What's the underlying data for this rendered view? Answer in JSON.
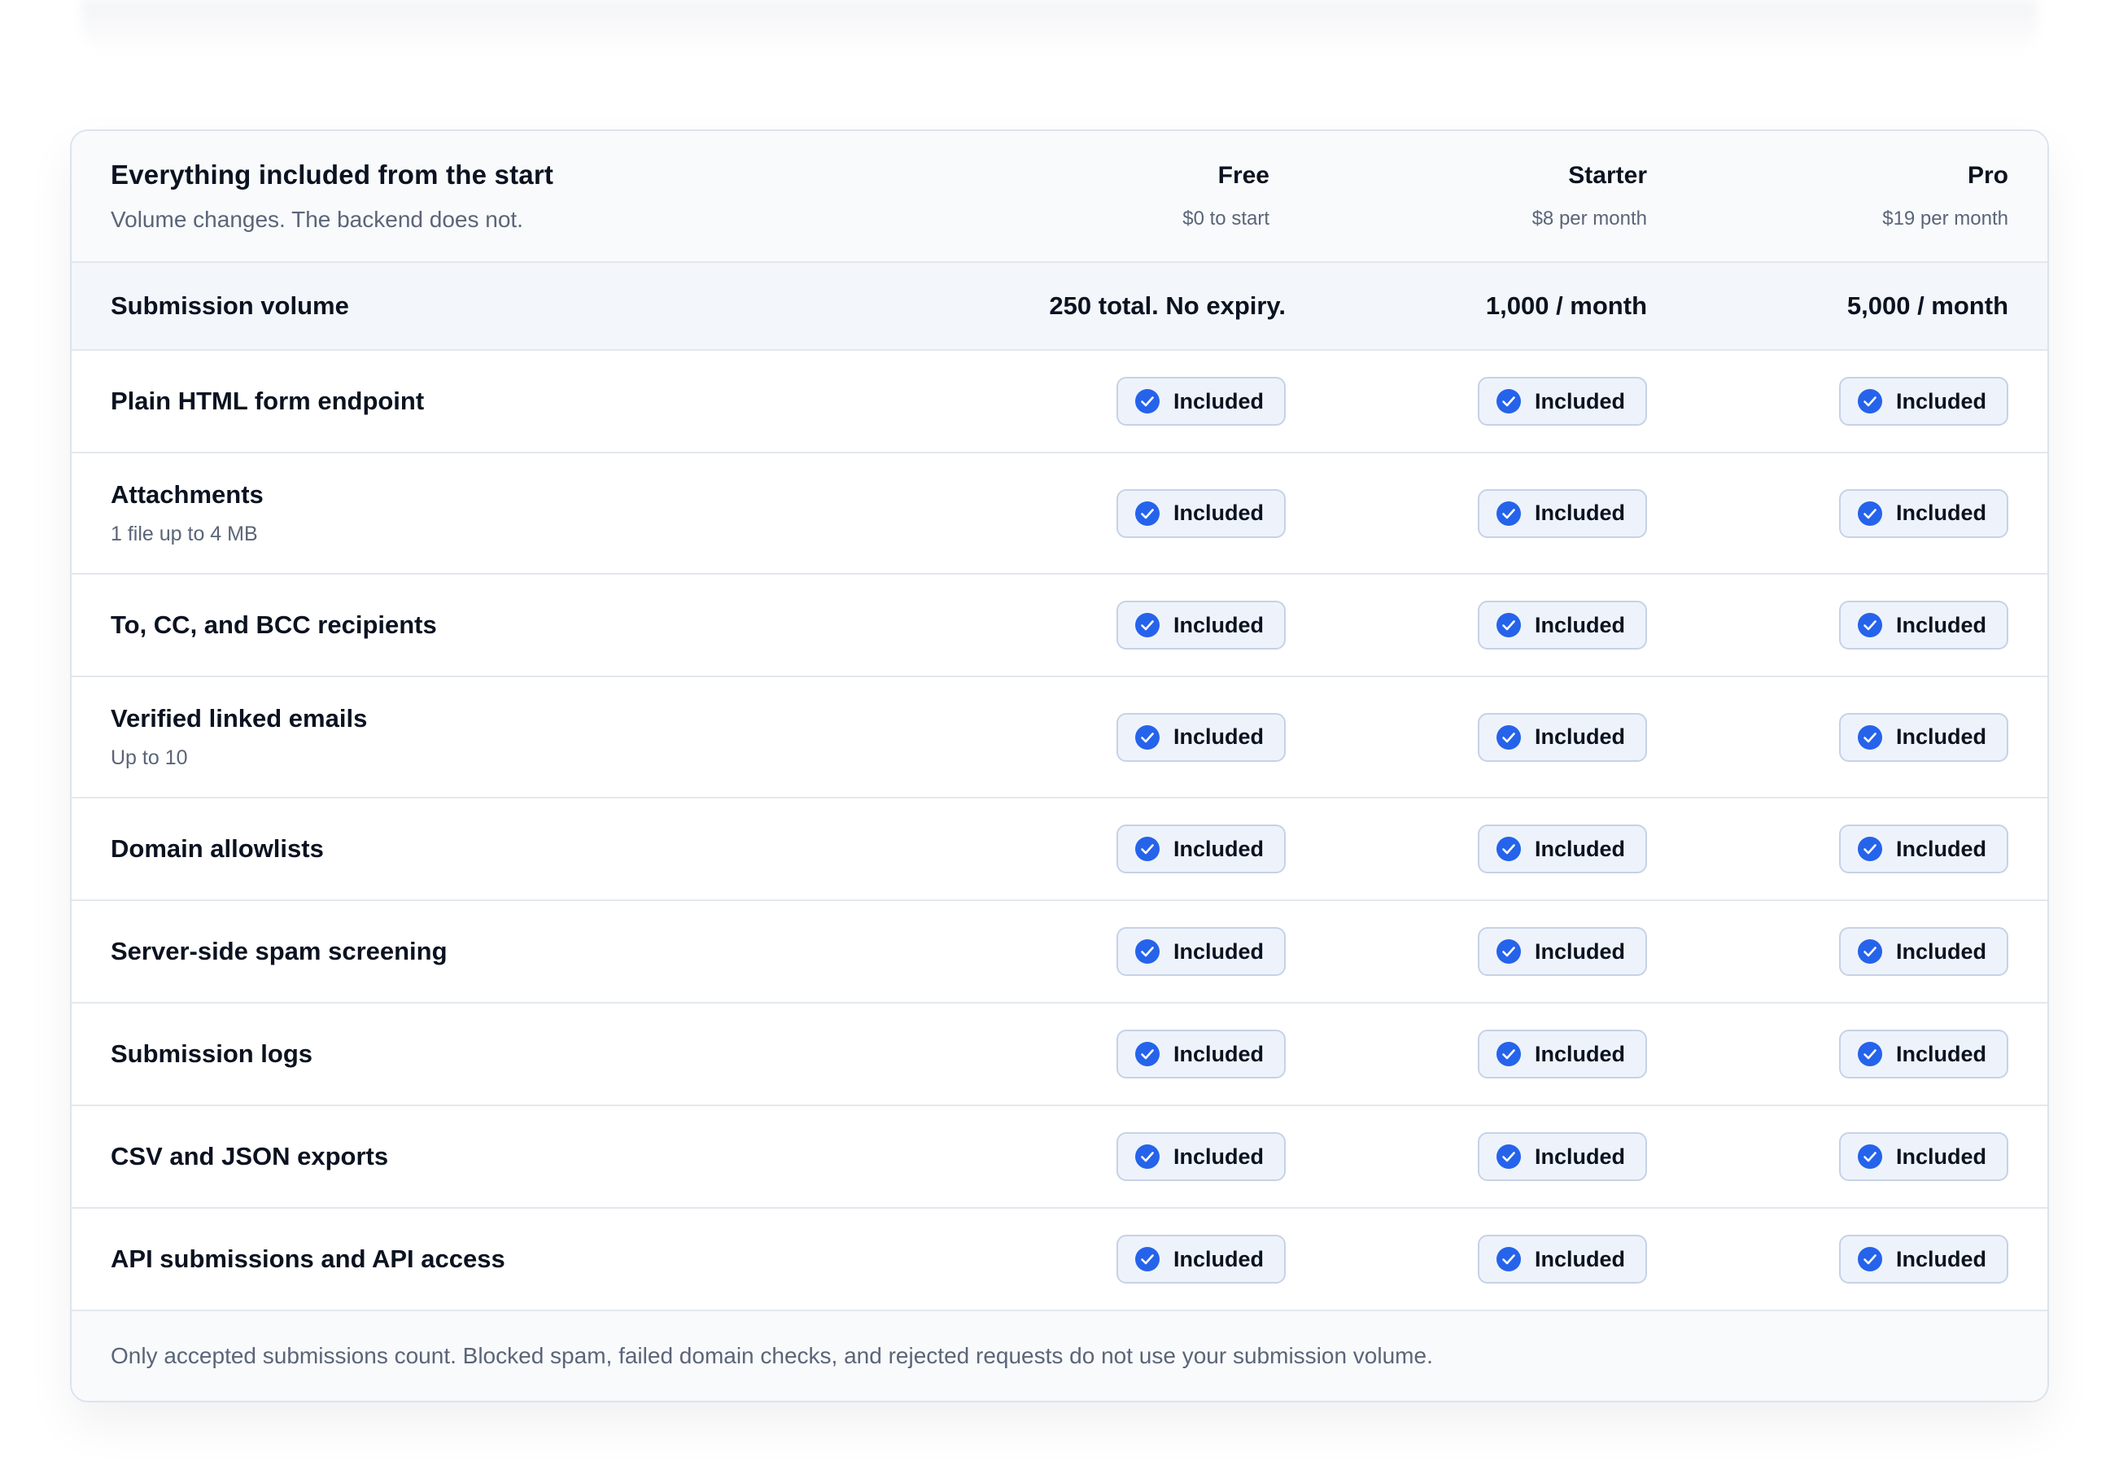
{
  "header": {
    "title": "Everything included from the start",
    "subtitle": "Volume changes. The backend does not."
  },
  "plans": [
    {
      "name": "Free",
      "price": "$0 to start"
    },
    {
      "name": "Starter",
      "price": "$8 per month"
    },
    {
      "name": "Pro",
      "price": "$19 per month"
    }
  ],
  "volume": {
    "label": "Submission volume",
    "values": [
      "250 total. No expiry.",
      "1,000 / month",
      "5,000 / month"
    ]
  },
  "badge": {
    "label": "Included",
    "icon": "check-circle-icon",
    "icon_color": "#2563eb"
  },
  "features": [
    {
      "label": "Plain HTML form endpoint",
      "note": ""
    },
    {
      "label": "Attachments",
      "note": "1 file up to 4 MB"
    },
    {
      "label": "To, CC, and BCC recipients",
      "note": ""
    },
    {
      "label": "Verified linked emails",
      "note": "Up to 10"
    },
    {
      "label": "Domain allowlists",
      "note": ""
    },
    {
      "label": "Server-side spam screening",
      "note": ""
    },
    {
      "label": "Submission logs",
      "note": ""
    },
    {
      "label": "CSV and JSON exports",
      "note": ""
    },
    {
      "label": "API submissions and API access",
      "note": ""
    }
  ],
  "footer": {
    "note": "Only accepted submissions count. Blocked spam, failed domain checks, and rejected requests do not use your submission volume."
  }
}
